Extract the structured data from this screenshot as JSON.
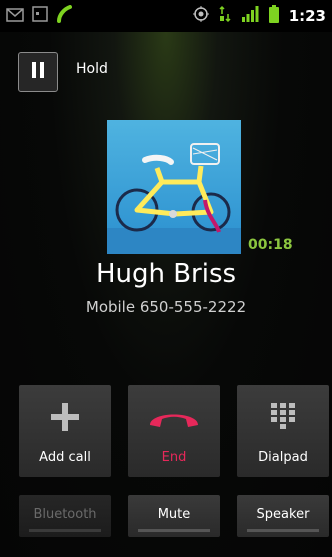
{
  "status_bar": {
    "time": "1:23",
    "icons_left": [
      "gmail-icon",
      "calendar-icon",
      "phone-call-icon"
    ],
    "icons_right": [
      "gps-icon",
      "data-icon",
      "signal-icon",
      "battery-icon"
    ]
  },
  "hold": {
    "label": "Hold"
  },
  "call": {
    "timer": "00:18",
    "name": "Hugh Briss",
    "number_line": "Mobile 650-555-2222"
  },
  "actions": {
    "add_call": "Add call",
    "end": "End",
    "dialpad": "Dialpad",
    "bluetooth": "Bluetooth",
    "mute": "Mute",
    "speaker": "Speaker"
  },
  "colors": {
    "accent_green": "#8cc63f",
    "end_red": "#e6285a",
    "disabled_text": "#6a6a6a"
  }
}
